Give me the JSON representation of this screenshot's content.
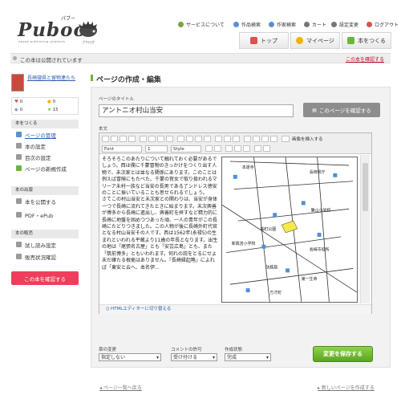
{
  "brand": {
    "logo": "Puboo",
    "logo_ruby": "パブー",
    "tagline": "ebook publishing platform",
    "ruby2": "ブクログ"
  },
  "top_links": [
    "サービスについて",
    "作品検索",
    "作家検索",
    "カート",
    "設定変更",
    "ログアウト"
  ],
  "nav": [
    {
      "label": "トップ",
      "color": "#d9534f"
    },
    {
      "label": "マイページ",
      "color": "#f0b400"
    },
    {
      "label": "本をつくる",
      "color": "#6bb53b"
    }
  ],
  "status": {
    "text": "この本は公開されています",
    "link": "この本を確認する"
  },
  "sidebar": {
    "book_title": "長崎寝県と留物連たち",
    "stats": [
      {
        "icon": "heart-icon",
        "value": "0"
      },
      {
        "icon": "comment-icon",
        "value": "0"
      },
      {
        "icon": "eye-icon",
        "value": "0"
      },
      {
        "icon": "star-icon",
        "value": "15"
      }
    ],
    "sections": [
      {
        "heading": "本をつくる",
        "items": [
          "ページの管理",
          "本の設定",
          "目次の設定",
          "ページの新規作成"
        ]
      },
      {
        "heading": "本の出版",
        "items": [
          "本を公開する",
          "PDF・ePub"
        ]
      },
      {
        "heading": "本の販売",
        "items": [
          "試し読み設定",
          "販売状況確認"
        ]
      }
    ],
    "confirm_button": "この本を確認する"
  },
  "main": {
    "page_heading": "ページの作成・編集",
    "title_label": "ページのタイトル",
    "title_value": "アントニオ村山当安",
    "confirm_page_button": "このページを確認する",
    "body_label": "本文",
    "toolbar": {
      "font": "Font",
      "size": "1",
      "style": "Style",
      "insert_image": "画像を挿入する"
    },
    "body_text": [
      "そろそろこのあたりについて触れておく必要があるでしょう。西は僕に千蒙冒物のきっかけをつくり出す人物で、未次家とは並なる関係にあります。このことは例えば冒険にもたべた、千蒙の賀女で取り扱われるマリーア未村一族など当安の長男である了ンドレス徳安のことに振いていることも思せられるでしょう。",
      "さてこの村山当安と未次家との関わりは、当安が身体一つで長崎に流れてきたときに始まります。末次興善が博多から長崎に進出し、興善町を拝すなど精力的に長崎に地盤を固めつつあった頃、一人の青年がこの長崎にたどりつきました。この人物が後に長崎外町代官となる村山当安その人です。西は1562年(永禄5)の生まれといわれる平蔵より11歳の年長となります。出生の地は「尾張名古屋」とも「安芸広島」とも、また「筑前博多」ともいわれます。何れの説をとるにせよ未だ確たる根拠はありません。『長崎縁起略』によれば「東安と云へ、本名伊..."
    ],
    "map_labels": [
      "本運寺",
      "長崎県庁",
      "勝山小学校",
      "桜町公園",
      "新興善小学校",
      "長崎市役所",
      "法務局",
      "第一生命",
      "万才町"
    ],
    "html_switch": "HTMLエディターに切り替える",
    "selects": [
      {
        "label": "章の変更",
        "value": "指定しない"
      },
      {
        "label": "コメントの許可",
        "value": "受け付ける"
      },
      {
        "label": "作成状態",
        "value": "完成"
      }
    ],
    "save_button": "変更を保存する"
  },
  "footer": {
    "prev": "ページ一覧へ戻る",
    "next": "新しいページを作成する"
  }
}
